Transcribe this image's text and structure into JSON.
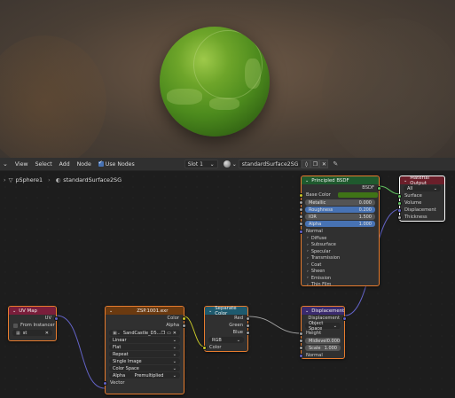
{
  "header": {
    "menus": [
      "View",
      "Select",
      "Add",
      "Node"
    ],
    "use_nodes_label": "Use Nodes",
    "slot_label": "Slot 1",
    "material_name": "standardSurface2SG"
  },
  "breadcrumb": {
    "object": "pSphere1",
    "material": "standardSurface2SG"
  },
  "nodes": {
    "principled": {
      "title": "Principled BSDF",
      "output": "BSDF",
      "base_color": "Base Color",
      "metallic_label": "Metallic",
      "metallic_value": "0.000",
      "roughness_label": "Roughness",
      "roughness_value": "0.200",
      "ior_label": "IOR",
      "ior_value": "1.500",
      "alpha_label": "Alpha",
      "alpha_value": "1.000",
      "normal": "Normal",
      "panels": [
        "Diffuse",
        "Subsurface",
        "Specular",
        "Transmission",
        "Coat",
        "Sheen",
        "Emission",
        "Thin Film"
      ]
    },
    "output": {
      "title": "Material Output",
      "target": "All",
      "surface": "Surface",
      "volume": "Volume",
      "displacement": "Displacement",
      "thickness": "Thickness"
    },
    "uvmap": {
      "title": "UV Map",
      "out": "UV",
      "from_instancer": "From Instancer",
      "field": "st"
    },
    "image": {
      "title": "ZSP.1001.exr",
      "out_color": "Color",
      "out_alpha": "Alpha",
      "image_name": "SandCastle_D5...",
      "interpolation": "Linear",
      "projection": "Flat",
      "extension": "Repeat",
      "source": "Single Image",
      "color_space_label": "Color Space",
      "alpha_label": "Alpha",
      "alpha_mode": "Premultiplied",
      "in_vector": "Vector"
    },
    "separate": {
      "title": "Separate Color",
      "red": "Red",
      "green": "Green",
      "blue": "Blue",
      "mode": "RGB",
      "in_color": "Color"
    },
    "displacement": {
      "title": "Displacement",
      "out": "Displacement",
      "space": "Object Space",
      "height": "Height",
      "midlevel_label": "Midlevel",
      "midlevel_value": "0.000",
      "scale_label": "Scale",
      "scale_value": "1.000",
      "normal": "Normal"
    }
  },
  "colors": {
    "shader_header": "#1f5a2e",
    "output_header": "#6b1f2a",
    "input_header": "#7a1e3b",
    "texture_header": "#6b3a10",
    "converter_header": "#1e5a6e",
    "vector_header": "#3b2a6e",
    "selection": "#e77c2e"
  }
}
